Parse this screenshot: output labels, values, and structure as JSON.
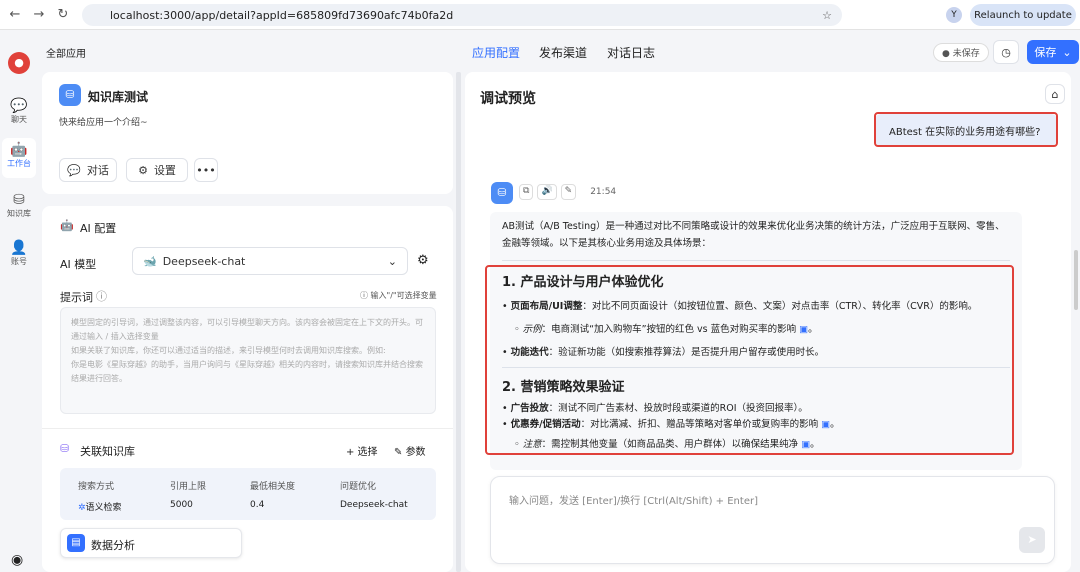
{
  "browser": {
    "url": "localhost:3000/app/detail?appId=685809fd73690afc74b0fa2d",
    "relaunch": "Relaunch to update",
    "profile": "Y"
  },
  "sidebar": {
    "items": [
      {
        "label": "聊天",
        "icon": "chat-icon"
      },
      {
        "label": "工作台",
        "icon": "robot-icon"
      },
      {
        "label": "知识库",
        "icon": "database-icon"
      },
      {
        "label": "账号",
        "icon": "user-icon"
      }
    ]
  },
  "topbar": {
    "back": "全部应用",
    "tabs": [
      "应用配置",
      "发布渠道",
      "对话日志"
    ],
    "unsaved": "未保存",
    "save": "保存"
  },
  "app": {
    "name": "知识库测试",
    "intro": "快来给应用一个介绍~",
    "chat_btn": "对话",
    "settings_btn": "设置"
  },
  "ai": {
    "title": "AI 配置",
    "model_label": "AI 模型",
    "model": "Deepseek-chat",
    "prompt_label": "提示词",
    "prompt_hint": "输入\"/\"可选择变量",
    "prompt_placeholder": "模型固定的引导词，通过调整该内容，可以引导模型聊天方向。该内容会被固定在上下文的开头。可通过输入 / 插入选择变量\n如果关联了知识库，你还可以通过适当的描述，来引导模型何时去调用知识库搜索。例如:\n你是电影《星际穿越》的助手，当用户询问与《星际穿越》相关的内容时，请搜索知识库并结合搜索结果进行回答。"
  },
  "kb": {
    "title": "关联知识库",
    "select": "+ 选择",
    "params": "参数",
    "headers": [
      "搜索方式",
      "引用上限",
      "最低相关度",
      "问题优化"
    ],
    "values": [
      "语义检索",
      "5000",
      "0.4",
      "Deepseek-chat"
    ],
    "dataset": "数据分析"
  },
  "chat": {
    "title": "调试预览",
    "user_msg": "ABtest 在实际的业务用途有哪些?",
    "time": "21:54",
    "intro": "AB测试（A/B Testing）是一种通过对比不同策略或设计的效果来优化业务决策的统计方法，广泛应用于互联网、零售、金融等领域。以下是其核心业务用途及具体场景：",
    "h1": "1. 产品设计与用户体验优化",
    "b1_bold": "页面布局/UI调整",
    "b1": "：对比不同页面设计（如按钮位置、颜色、文案）对点击率（CTR）、转化率（CVR）的影响。",
    "s1_it": "示例",
    "s1": "：电商测试“加入购物车”按钮的红色 vs 蓝色对购买率的影响",
    "b2_bold": "功能迭代",
    "b2": "：验证新功能（如搜索推荐算法）是否提升用户留存或使用时长。",
    "h2": "2. 营销策略效果验证",
    "b3_bold": "广告投放",
    "b3": "：测试不同广告素材、投放时段或渠道的ROI（投资回报率）。",
    "b4_bold": "优惠券/促销活动",
    "b4": "：对比满减、折扣、赠品等策略对客单价或复购率的影响",
    "s2_it": "注意",
    "s2": "：需控制其他变量（如商品品类、用户群体）以确保结果纯净",
    "input_placeholder": "输入问题，发送 [Enter]/换行 [Ctrl(Alt/Shift) + Enter]"
  },
  "colors": {
    "accent": "#3370ff",
    "highlight": "#e0413a"
  }
}
